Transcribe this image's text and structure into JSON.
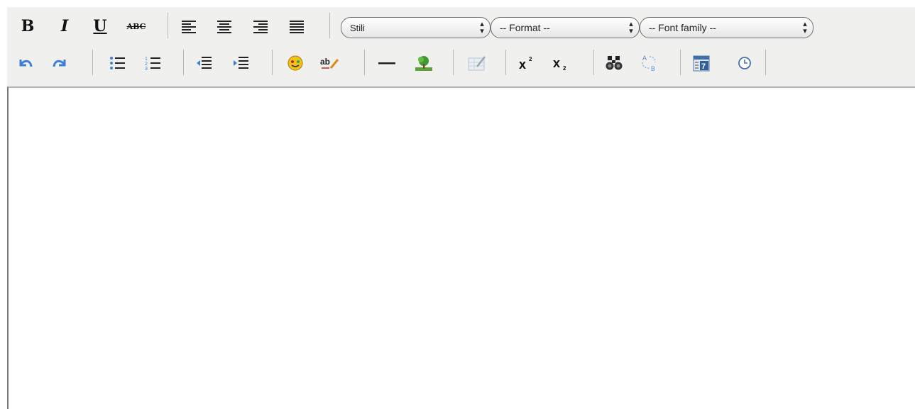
{
  "toolbar": {
    "row1": {
      "bold_label": "B",
      "italic_label": "I",
      "underline_label": "U",
      "strike_label": "ABC",
      "styles_select": {
        "value": "Stili",
        "options": [
          "Stili"
        ]
      },
      "format_select": {
        "value": "-- Format --",
        "options": [
          "-- Format --"
        ]
      },
      "fontfamily_select": {
        "value": "-- Font family --",
        "options": [
          "-- Font family --"
        ]
      }
    },
    "row2": {
      "icons": [
        "undo-icon",
        "redo-icon",
        "bullet-list-icon",
        "numbered-list-icon",
        "outdent-icon",
        "indent-icon",
        "emotions-icon",
        "spellcheck-icon",
        "horizontal-rule-icon",
        "image-icon",
        "cleanup-icon",
        "superscript-icon",
        "subscript-icon",
        "search-icon",
        "replace-icon",
        "insert-date-icon",
        "insert-time-icon"
      ],
      "spellcheck_label": "ab",
      "superscript_label": "x",
      "subscript_label": "x",
      "replace_label_a": "A",
      "replace_label_b": "B",
      "date_label": "7"
    }
  },
  "editor": {
    "content": ""
  },
  "colors": {
    "toolbar_bg": "#f0f0ee",
    "icon_blue": "#3d7fd6",
    "border": "#777777"
  }
}
